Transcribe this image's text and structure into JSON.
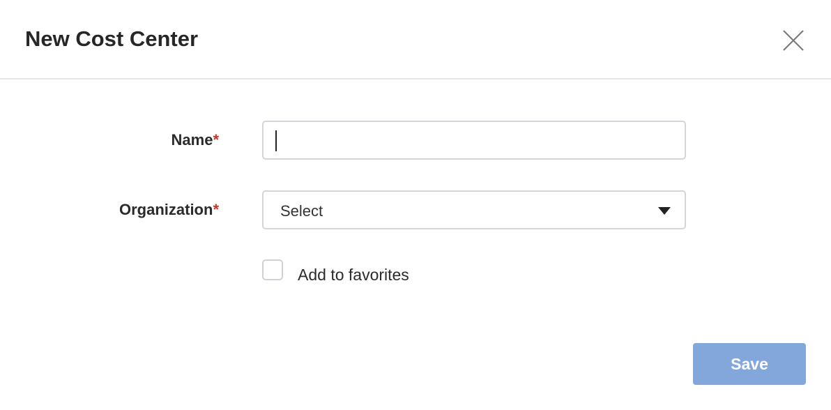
{
  "dialog": {
    "title": "New Cost Center",
    "close_icon": "close-icon"
  },
  "form": {
    "name": {
      "label": "Name",
      "required_mark": "*",
      "value": ""
    },
    "organization": {
      "label": "Organization",
      "required_mark": "*",
      "selected": "Select",
      "icon": "caret-down-icon"
    },
    "favorites": {
      "label": "Add to favorites",
      "checked": false
    }
  },
  "footer": {
    "save_label": "Save"
  },
  "colors": {
    "save_button": "#84a7db",
    "required": "#c0392b",
    "border": "#d2d5d9"
  }
}
